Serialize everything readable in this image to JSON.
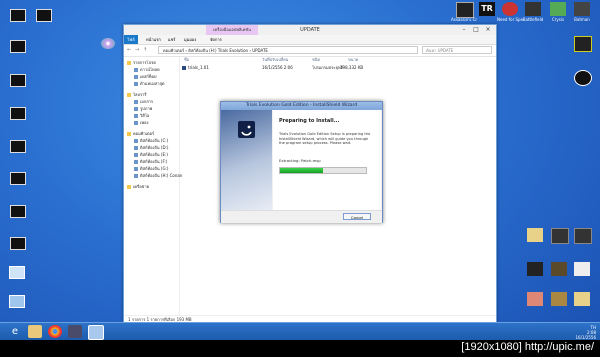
{
  "explorer": {
    "context_tab": "เครื่องมือแอปพลิเคชัน",
    "title": "UPDATE",
    "ribbon": [
      "ไฟล์",
      "หน้าแรก",
      "แชร์",
      "มุมมอง",
      "จัดการ"
    ],
    "address": "คอมพิวเตอร์  ›  ดิสก์ท้องถิ่น (H:) Trials Evolution  ›  UPDATE",
    "search_placeholder": "ค้นหา UPDATE",
    "nav": [
      {
        "label": "รายการโปรด",
        "group": true
      },
      {
        "label": "ดาวน์โหลด"
      },
      {
        "label": "เดสก์ท็อป"
      },
      {
        "label": "ตำแหน่งล่าสุด"
      },
      {
        "label": "ไลบรารี",
        "group": true
      },
      {
        "label": "เอกสาร"
      },
      {
        "label": "รูปภาพ"
      },
      {
        "label": "วิดีโอ"
      },
      {
        "label": "เพลง"
      },
      {
        "label": "คอมพิวเตอร์",
        "group": true
      },
      {
        "label": "ดิสก์ท้องถิ่น (C:)"
      },
      {
        "label": "ดิสก์ท้องถิ่น (D:)"
      },
      {
        "label": "ดิสก์ท้องถิ่น (E:)"
      },
      {
        "label": "ดิสก์ท้องถิ่น (F:)"
      },
      {
        "label": "ดิสก์ท้องถิ่น (G:)"
      },
      {
        "label": "ดิสก์ท้องถิ่น (H:) Conan"
      },
      {
        "label": "เครือข่าย",
        "group": true
      }
    ],
    "columns": [
      "ชื่อ",
      "วันที่ปรับเปลี่ยน",
      "ชนิด",
      "ขนาด"
    ],
    "files": [
      {
        "name": "trials_1.01",
        "date": "16/1/2556 2:06",
        "type": "โปรแกรมประยุกต์",
        "size": "198,332 KB"
      }
    ],
    "status": "1 รายการ    1 รายการที่เลือก 193 MB"
  },
  "installer": {
    "title": "Trials Evolution Gold Edition - InstallShield Wizard",
    "heading": "Preparing to Install...",
    "description": "Trials Evolution Gold Edition Setup is preparing the InstallShield Wizard, which will guide you through the program setup process.  Please wait.",
    "status": "Extracting: Patch.msp",
    "progress": 0.5,
    "cancel": "Cancel"
  },
  "desktop_icons_right": [
    {
      "label": "Assassin's Creed"
    },
    {
      "label": "TR"
    },
    {
      "label": "Need for Speed"
    },
    {
      "label": "Battlefield"
    },
    {
      "label": "Crysis"
    },
    {
      "label": "Batman"
    },
    {
      "label": "Far Cry 3"
    }
  ],
  "tray": {
    "lang": "TH",
    "time": "2:08",
    "date": "16/1/2556"
  },
  "watermark": "[1920x1080] http://upic.me/"
}
